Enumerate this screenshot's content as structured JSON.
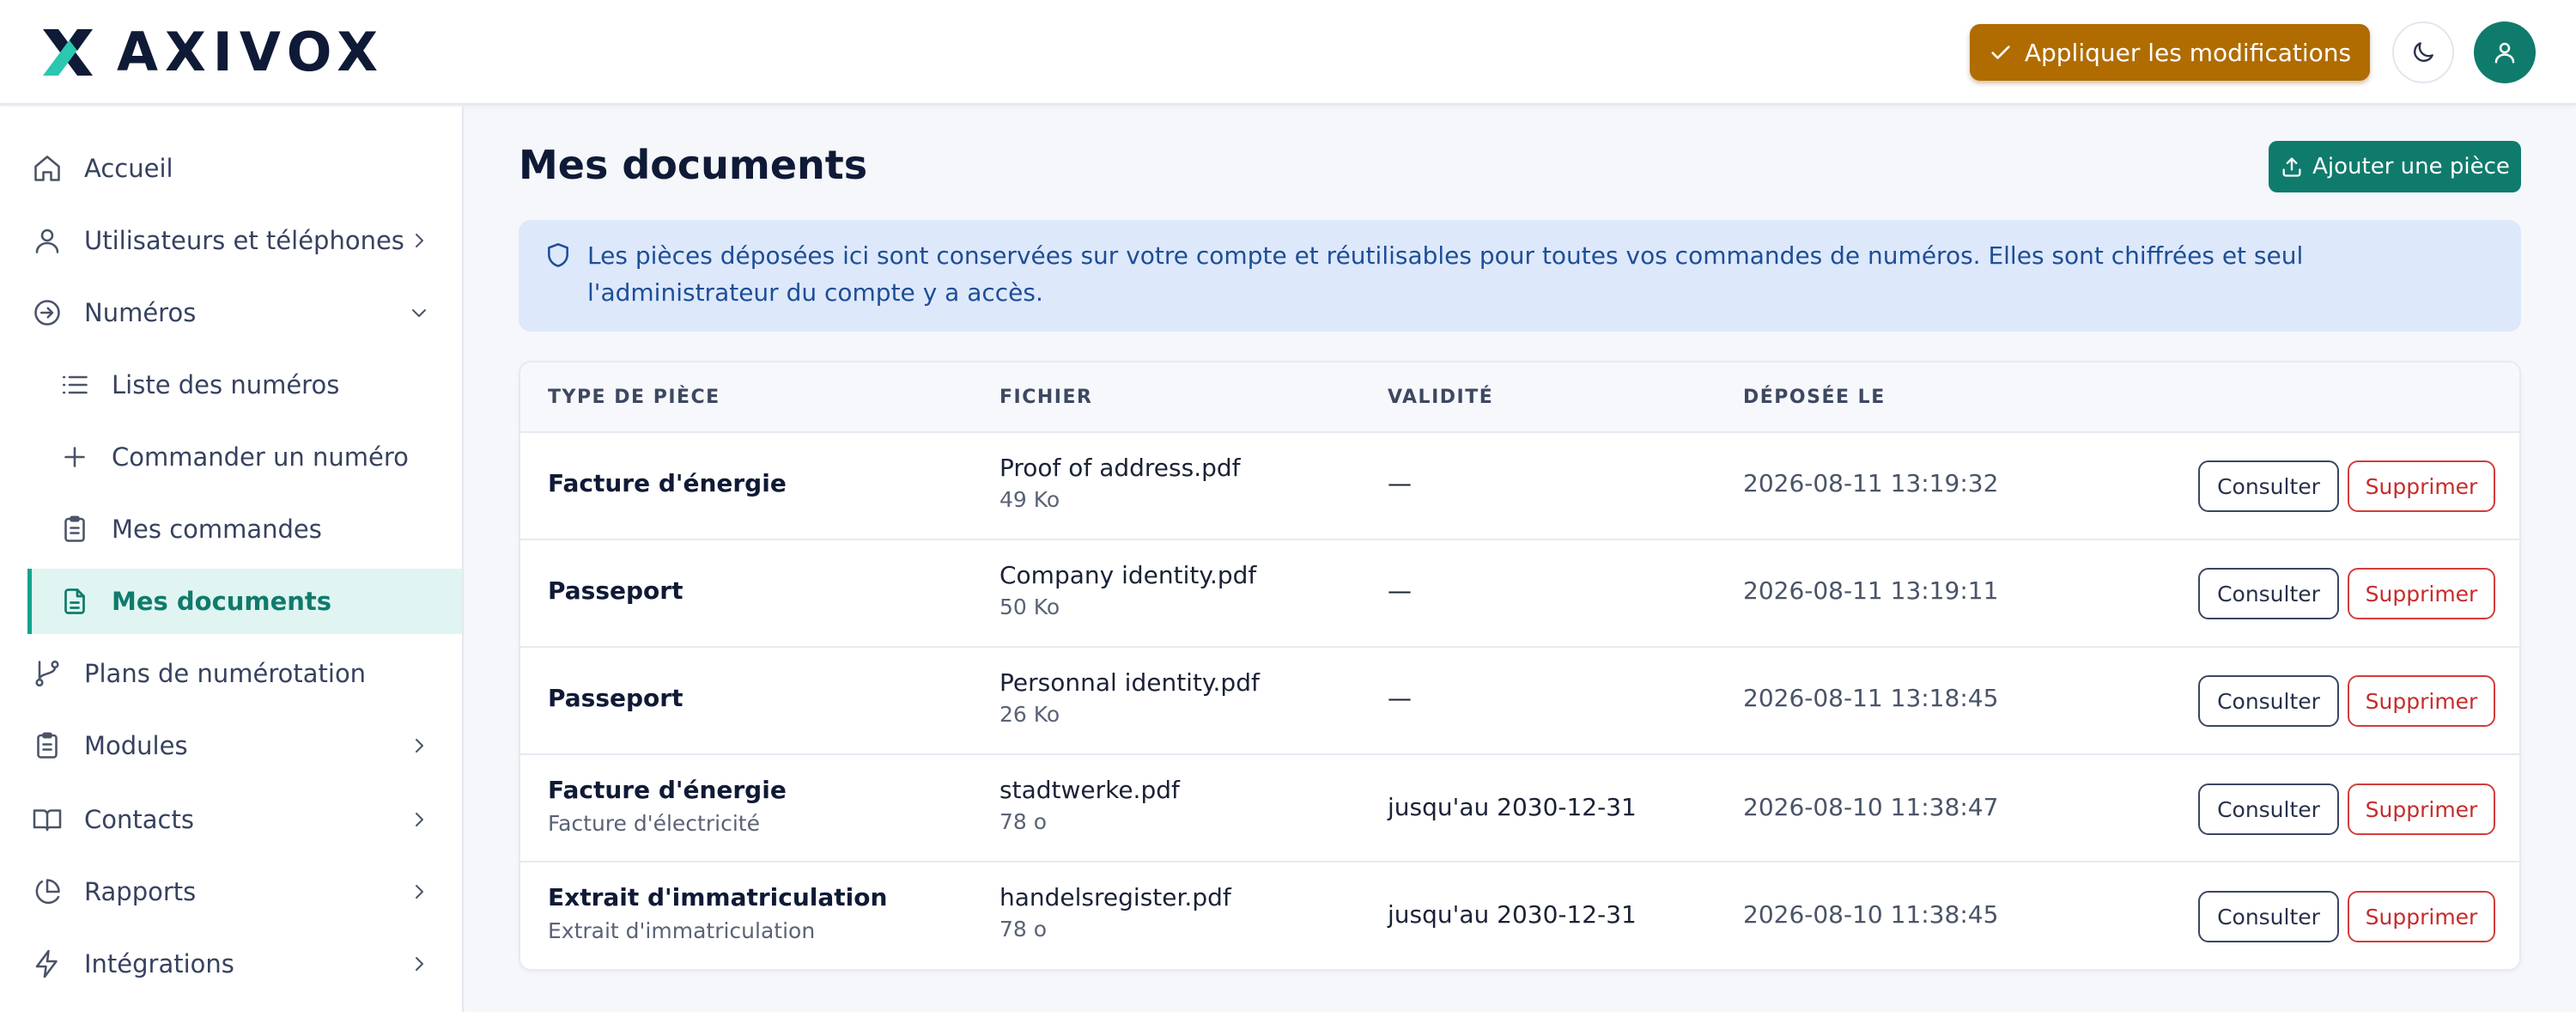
{
  "header": {
    "brand": "AXIVOX",
    "apply_label": "Appliquer les modifications"
  },
  "sidebar": {
    "items": [
      {
        "label": "Accueil",
        "icon": "home-icon"
      },
      {
        "label": "Utilisateurs et téléphones",
        "icon": "user-icon"
      },
      {
        "label": "Numéros",
        "icon": "arrow-circle-icon"
      },
      {
        "label": "Liste des numéros",
        "icon": "list-icon"
      },
      {
        "label": "Commander un numéro",
        "icon": "plus-icon"
      },
      {
        "label": "Mes commandes",
        "icon": "clipboard-icon"
      },
      {
        "label": "Mes documents",
        "icon": "document-icon"
      },
      {
        "label": "Plans de numérotation",
        "icon": "git-branch-icon"
      },
      {
        "label": "Modules",
        "icon": "clipboard-icon"
      },
      {
        "label": "Contacts",
        "icon": "book-icon"
      },
      {
        "label": "Rapports",
        "icon": "pie-chart-icon"
      },
      {
        "label": "Intégrations",
        "icon": "zap-icon"
      }
    ]
  },
  "main": {
    "title": "Mes documents",
    "add_label": "Ajouter une pièce",
    "info_text": "Les pièces déposées ici sont conservées sur votre compte et réutilisables pour toutes vos commandes de numéros. Elles sont chiffrées et seul l'administrateur du compte y a accès.",
    "table": {
      "headers": [
        "TYPE DE PIÈCE",
        "FICHIER",
        "VALIDITÉ",
        "DÉPOSÉE LE"
      ],
      "consult_label": "Consulter",
      "delete_label": "Supprimer",
      "rows": [
        {
          "type": "Facture d'énergie",
          "subtype": "",
          "file": "Proof of address.pdf",
          "size": "49 Ko",
          "validity": "—",
          "deposited": "2026-08-11 13:19:32"
        },
        {
          "type": "Passeport",
          "subtype": "",
          "file": "Company identity.pdf",
          "size": "50 Ko",
          "validity": "—",
          "deposited": "2026-08-11 13:19:11"
        },
        {
          "type": "Passeport",
          "subtype": "",
          "file": "Personnal identity.pdf",
          "size": "26 Ko",
          "validity": "—",
          "deposited": "2026-08-11 13:18:45"
        },
        {
          "type": "Facture d'énergie",
          "subtype": "Facture d'électricité",
          "file": "stadtwerke.pdf",
          "size": "78 o",
          "validity": "jusqu'au 2030-12-31",
          "deposited": "2026-08-10 11:38:47"
        },
        {
          "type": "Extrait d'immatriculation",
          "subtype": "Extrait d'immatriculation",
          "file": "handelsregister.pdf",
          "size": "78 o",
          "validity": "jusqu'au 2030-12-31",
          "deposited": "2026-08-10 11:38:45"
        }
      ]
    }
  },
  "colors": {
    "accent": "#0f7b6c",
    "apply": "#b06c00",
    "info_bg": "#dde8fb",
    "danger": "#c72b2b"
  }
}
